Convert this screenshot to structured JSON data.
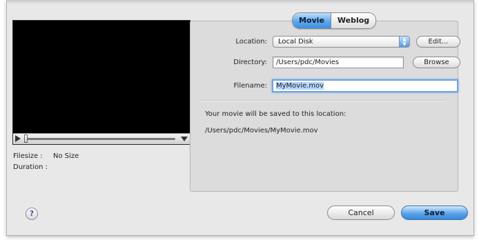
{
  "tabs": [
    "Movie",
    "Weblog"
  ],
  "selected_tab": "Movie",
  "location": {
    "label": "Location:",
    "value": "Local Disk",
    "edit_label": "Edit..."
  },
  "directory": {
    "label": "Directory:",
    "value": "/Users/pdc/Movies",
    "browse_label": "Browse"
  },
  "filename": {
    "label": "Filename:",
    "value": "MyMovie.mov"
  },
  "note": {
    "text": "Your movie will be saved to this location:",
    "path": "/Users/pdc/Movies/MyMovie.mov"
  },
  "info": {
    "filesize_label": "Filesize :",
    "filesize_value": "No Size",
    "duration_label": "Duration :",
    "duration_value": ""
  },
  "buttons": {
    "help": "?",
    "cancel": "Cancel",
    "save": "Save"
  },
  "colors": {
    "accent": "#5ea7ec",
    "focus_ring": "#6aa3e3",
    "help_glyph": "#6b3fa4"
  },
  "icons": {
    "play": "play-icon",
    "volume": "volume-icon",
    "popup_arrows": "up-down-arrows-icon"
  }
}
